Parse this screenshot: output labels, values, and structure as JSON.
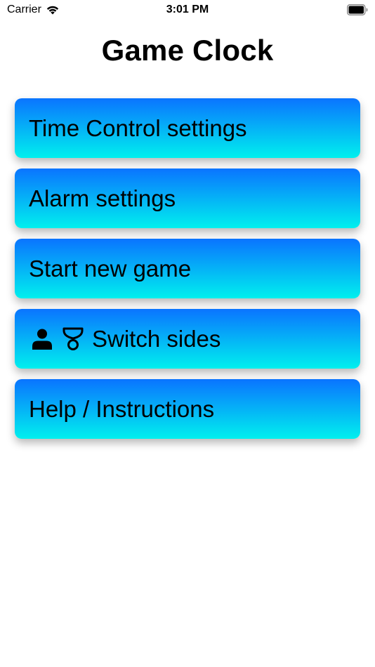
{
  "status_bar": {
    "carrier": "Carrier",
    "time": "3:01 PM",
    "wifi_icon": "wifi-icon",
    "battery_icon": "battery-icon"
  },
  "header": {
    "title": "Game Clock"
  },
  "menu": {
    "gradient_top": "#0a74ff",
    "gradient_bottom": "#00f0ee",
    "items": [
      {
        "label": "Time Control settings"
      },
      {
        "label": "Alarm settings"
      },
      {
        "label": "Start new game"
      },
      {
        "label": "Switch sides",
        "icons": [
          "person-icon",
          "timer-icon"
        ]
      },
      {
        "label": "Help / Instructions"
      }
    ]
  }
}
